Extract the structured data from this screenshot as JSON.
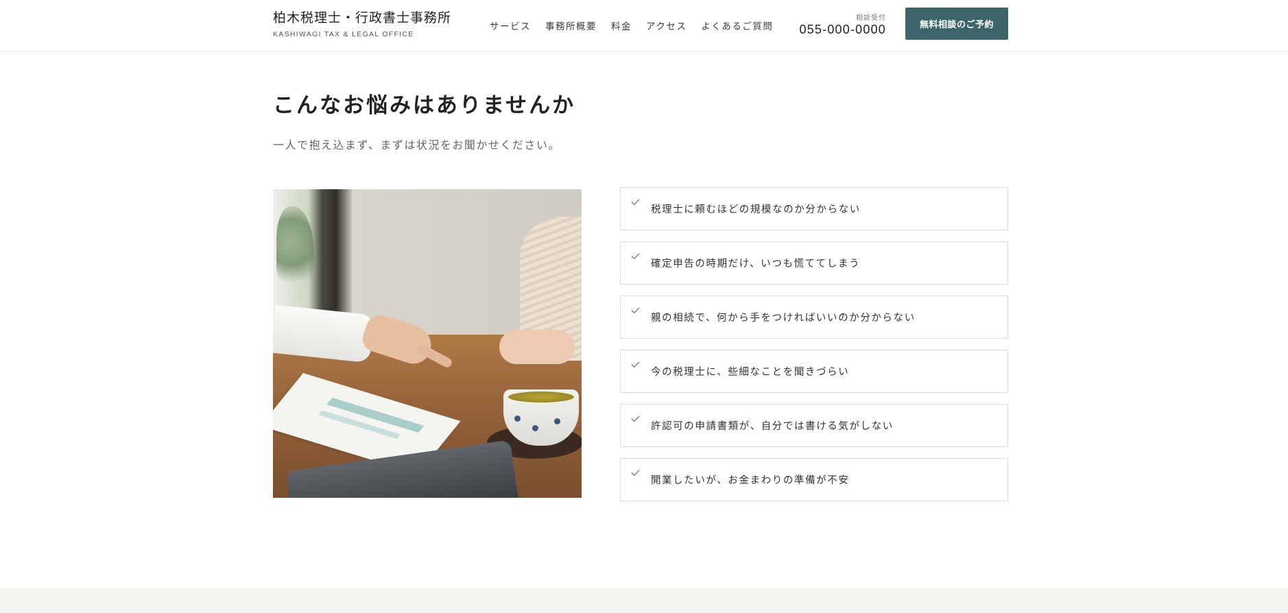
{
  "header": {
    "logo_jp": "柏木税理士・行政書士事務所",
    "logo_en": "KASHIWAGI TAX & LEGAL OFFICE",
    "nav": [
      {
        "label": "サービス"
      },
      {
        "label": "事務所概要"
      },
      {
        "label": "料金"
      },
      {
        "label": "アクセス"
      },
      {
        "label": "よくあるご質問"
      }
    ],
    "tel_label": "相談受付",
    "tel_number": "055-000-0000",
    "cta_label": "無料相談のご予約"
  },
  "section": {
    "title": "こんなお悩みはありませんか",
    "subtitle": "一人で抱え込まず、まずは状況をお聞かせください。",
    "items": [
      {
        "text": "税理士に頼むほどの規模なのか分からない"
      },
      {
        "text": "確定申告の時期だけ、いつも慌ててしまう"
      },
      {
        "text": "親の相続で、何から手をつければいいのか分からない"
      },
      {
        "text": "今の税理士に、些細なことを聞きづらい"
      },
      {
        "text": "許認可の申請書類が、自分では書ける気がしない"
      },
      {
        "text": "開業したいが、お金まわりの準備が不安"
      }
    ]
  },
  "colors": {
    "accent": "#3c6569",
    "footer_band": "#f6f5f2"
  },
  "icons": {
    "check": "check-icon"
  }
}
